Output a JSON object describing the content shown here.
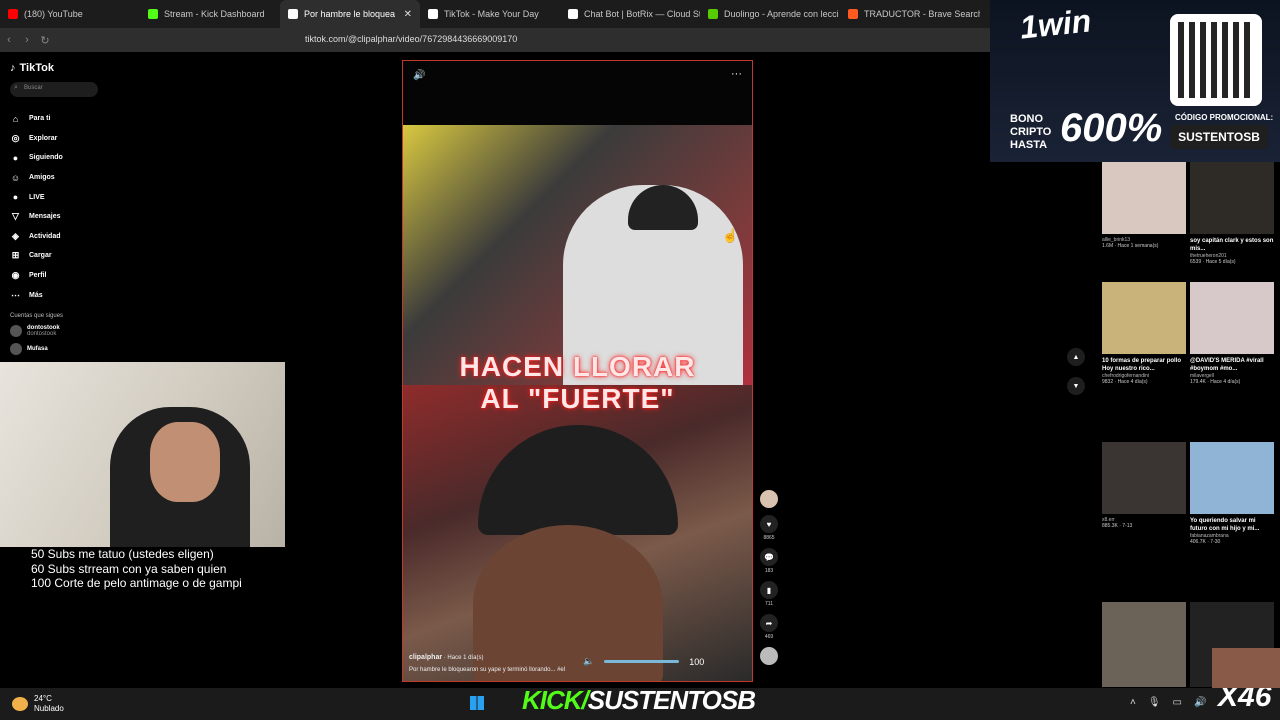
{
  "browser": {
    "tabs": [
      {
        "label": "(180) YouTube",
        "color": "#ff0000",
        "active": false
      },
      {
        "label": "Stream - Kick Dashboard",
        "color": "#53fc18",
        "active": false
      },
      {
        "label": "Por hambre le bloquea",
        "color": "#ffffff",
        "active": true
      },
      {
        "label": "TikTok - Make Your Day",
        "color": "#ffffff",
        "active": false
      },
      {
        "label": "Chat Bot | BotRix — Cloud Str",
        "color": "#ffffff",
        "active": false
      },
      {
        "label": "Duolingo - Aprende con lecci",
        "color": "#58cc02",
        "active": false
      },
      {
        "label": "TRADUCTOR - Brave Search",
        "color": "#ff5a1f",
        "active": false
      }
    ],
    "url": "tiktok.com/@clipalphar/video/7672984436669009170"
  },
  "tiktok": {
    "logo": "TikTok",
    "search_placeholder": "Buscar",
    "nav": [
      {
        "label": "Para ti",
        "icon": "home-icon"
      },
      {
        "label": "Explorar",
        "icon": "compass-icon"
      },
      {
        "label": "Siguiendo",
        "icon": "following-icon"
      },
      {
        "label": "Amigos",
        "icon": "friends-icon"
      },
      {
        "label": "LIVE",
        "icon": "live-icon"
      },
      {
        "label": "Mensajes",
        "icon": "messages-icon"
      },
      {
        "label": "Actividad",
        "icon": "activity-icon"
      },
      {
        "label": "Cargar",
        "icon": "upload-icon"
      },
      {
        "label": "Perfil",
        "icon": "profile-icon"
      },
      {
        "label": "Más",
        "icon": "more-icon"
      }
    ],
    "following_header": "Cuentas que sigues",
    "following": [
      {
        "name": "dontostook",
        "handle": "dontostook"
      },
      {
        "name": "Mufasa",
        "handle": ""
      }
    ]
  },
  "stream_goals": [
    "50 Subs me tatuo (ustedes eligen)",
    "60 Subs strream con ya saben quien",
    "100 Corte de pelo antimage o de gampi"
  ],
  "video": {
    "caption_line1": "HACEN LLORAR",
    "caption_line2": "AL \"FUERTE\"",
    "author": "clipalphar",
    "time_ago": "Hace 1 día(s)",
    "description": "Por hambre le bloquearon su yape y terminó llorando... #el",
    "volume": "100",
    "volume_level": 1.0,
    "likes": "8865",
    "comments": "183",
    "saves": "711",
    "shares": "469"
  },
  "ad": {
    "brand": "1win",
    "bonus_text_1": "BONO",
    "bonus_text_2": "CRIPTO",
    "bonus_text_3": "HASTA",
    "bonus_pct": "600%",
    "code_header": "CÓDIGO PROMOCIONAL:",
    "code": "SUSTENTOSB"
  },
  "recommended": [
    {
      "title": "",
      "user": "allie_brink13",
      "meta": "1.6M · Hace 1 semana(s)"
    },
    {
      "title": "soy capitán clark y estos son mis...",
      "user": "thetrueheron201",
      "meta": "6539 · Hace 5 día(s)"
    },
    {
      "title": "10 formas de preparar pollo Hoy nuestro rico...",
      "user": "chefrodrigofernandini",
      "meta": "9832 · Hace 4 día(s)"
    },
    {
      "title": "@DAVID'S MERIDA #virall #boymom #mo...",
      "user": "milavergell",
      "meta": "179.4K · Hace 4 día(s)"
    },
    {
      "title": "",
      "user": "x8.err",
      "meta": "885.3K · 7-13"
    },
    {
      "title": "Yo queriendo salvar mi futuro con mi hijo y mi...",
      "user": "fabianazambrana",
      "meta": "406.7K · 7-30"
    }
  ],
  "taskbar": {
    "temp": "24°C",
    "weather": "Nublado",
    "kick_prefix": "KICK/",
    "kick_channel": "SUSTENTOSB",
    "counter": "X46"
  }
}
